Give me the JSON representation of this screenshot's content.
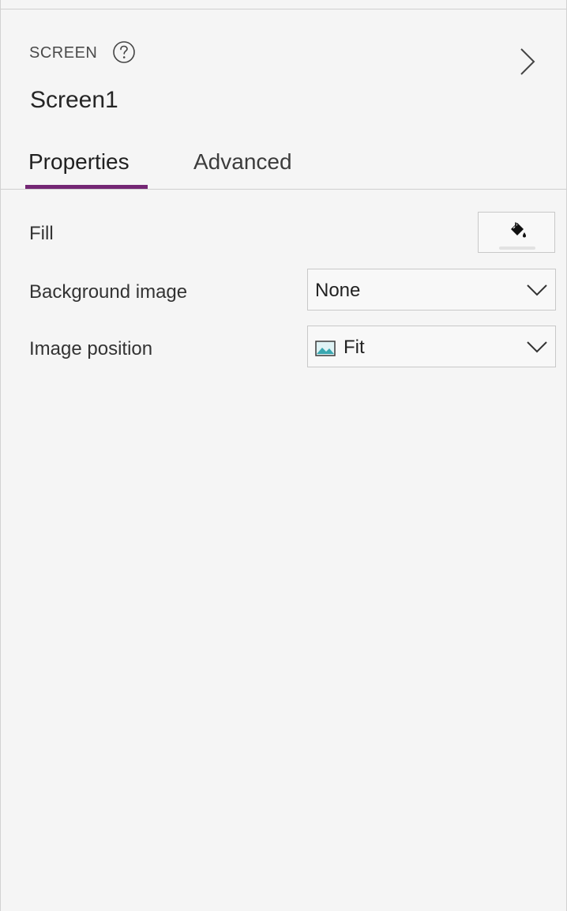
{
  "header": {
    "section_label": "SCREEN",
    "title": "Screen1"
  },
  "tabs": [
    {
      "label": "Properties",
      "active": true
    },
    {
      "label": "Advanced",
      "active": false
    }
  ],
  "properties": {
    "fill": {
      "label": "Fill"
    },
    "background_image": {
      "label": "Background image",
      "value": "None"
    },
    "image_position": {
      "label": "Image position",
      "value": "Fit"
    }
  },
  "colors": {
    "accent": "#742774",
    "panel_background": "#f5f5f5",
    "border": "#c8c8c8"
  },
  "icons": {
    "help": "question-circle-icon",
    "collapse": "chevron-right-icon",
    "fill": "paint-bucket-icon",
    "dropdown": "chevron-down-icon",
    "image_position": "image-icon"
  }
}
